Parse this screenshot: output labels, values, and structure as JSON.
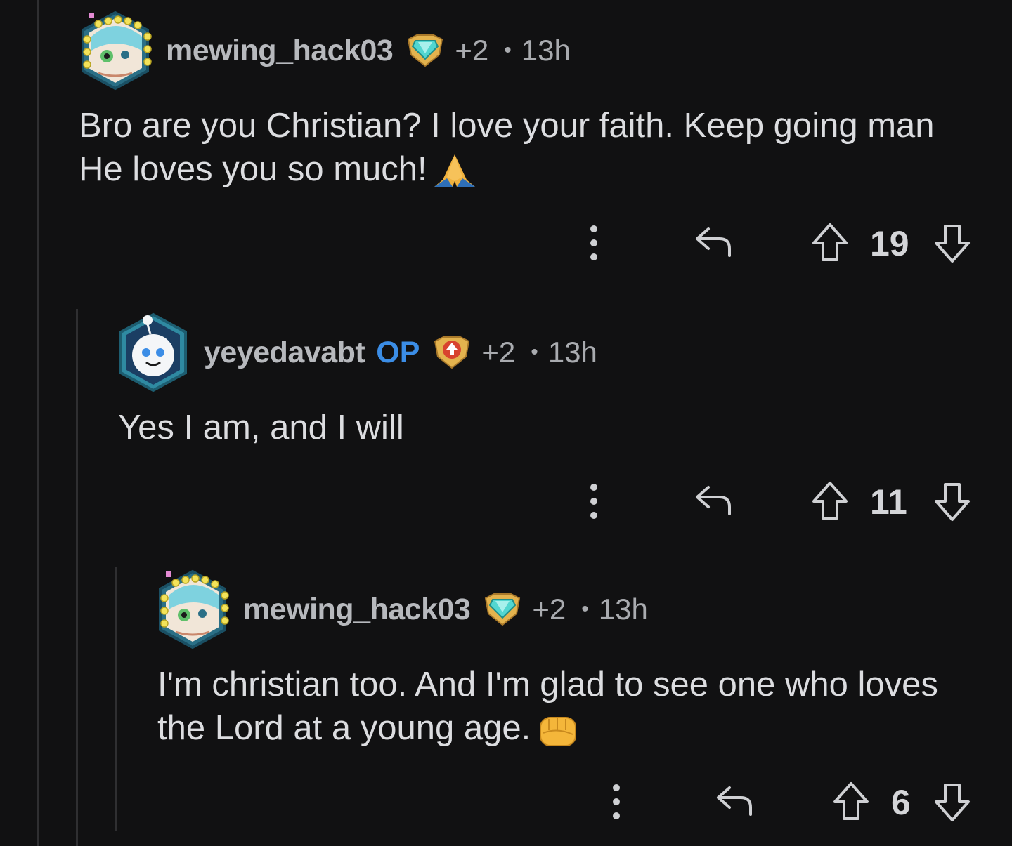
{
  "comments": [
    {
      "username": "mewing_hack03",
      "op_label": "",
      "karma_badge": "+2",
      "age": "13h",
      "text": "Bro are you Christian? I love your faith. Keep going man He loves you so much!",
      "emoji": "praying-hands",
      "votes": "19",
      "avatar_icon": "avatar-mewing-hack03-icon",
      "flair_icon": "diamond-shield-flair-icon",
      "accent_color": "#3b8de6"
    },
    {
      "username": "yeyedavabt",
      "op_label": "OP",
      "karma_badge": "+2",
      "age": "13h",
      "text": "Yes I am, and I will",
      "emoji": "",
      "votes": "11",
      "avatar_icon": "avatar-snoo-icon",
      "flair_icon": "upvote-shield-flair-icon",
      "accent_color": "#3b8de6"
    },
    {
      "username": "mewing_hack03",
      "op_label": "",
      "karma_badge": "+2",
      "age": "13h",
      "text": "I'm christian too. And I'm glad to see one who loves the Lord at a young age.",
      "emoji": "fist",
      "votes": "6",
      "avatar_icon": "avatar-mewing-hack03-icon",
      "flair_icon": "diamond-shield-flair-icon",
      "accent_color": "#3b8de6"
    }
  ],
  "icons": {
    "more": "more-options-icon",
    "reply": "reply-icon",
    "upvote": "upvote-icon",
    "downvote": "downvote-icon"
  },
  "colors": {
    "background": "#111112",
    "thread_line": "#2f2f31",
    "op_blue": "#3b8de6"
  }
}
